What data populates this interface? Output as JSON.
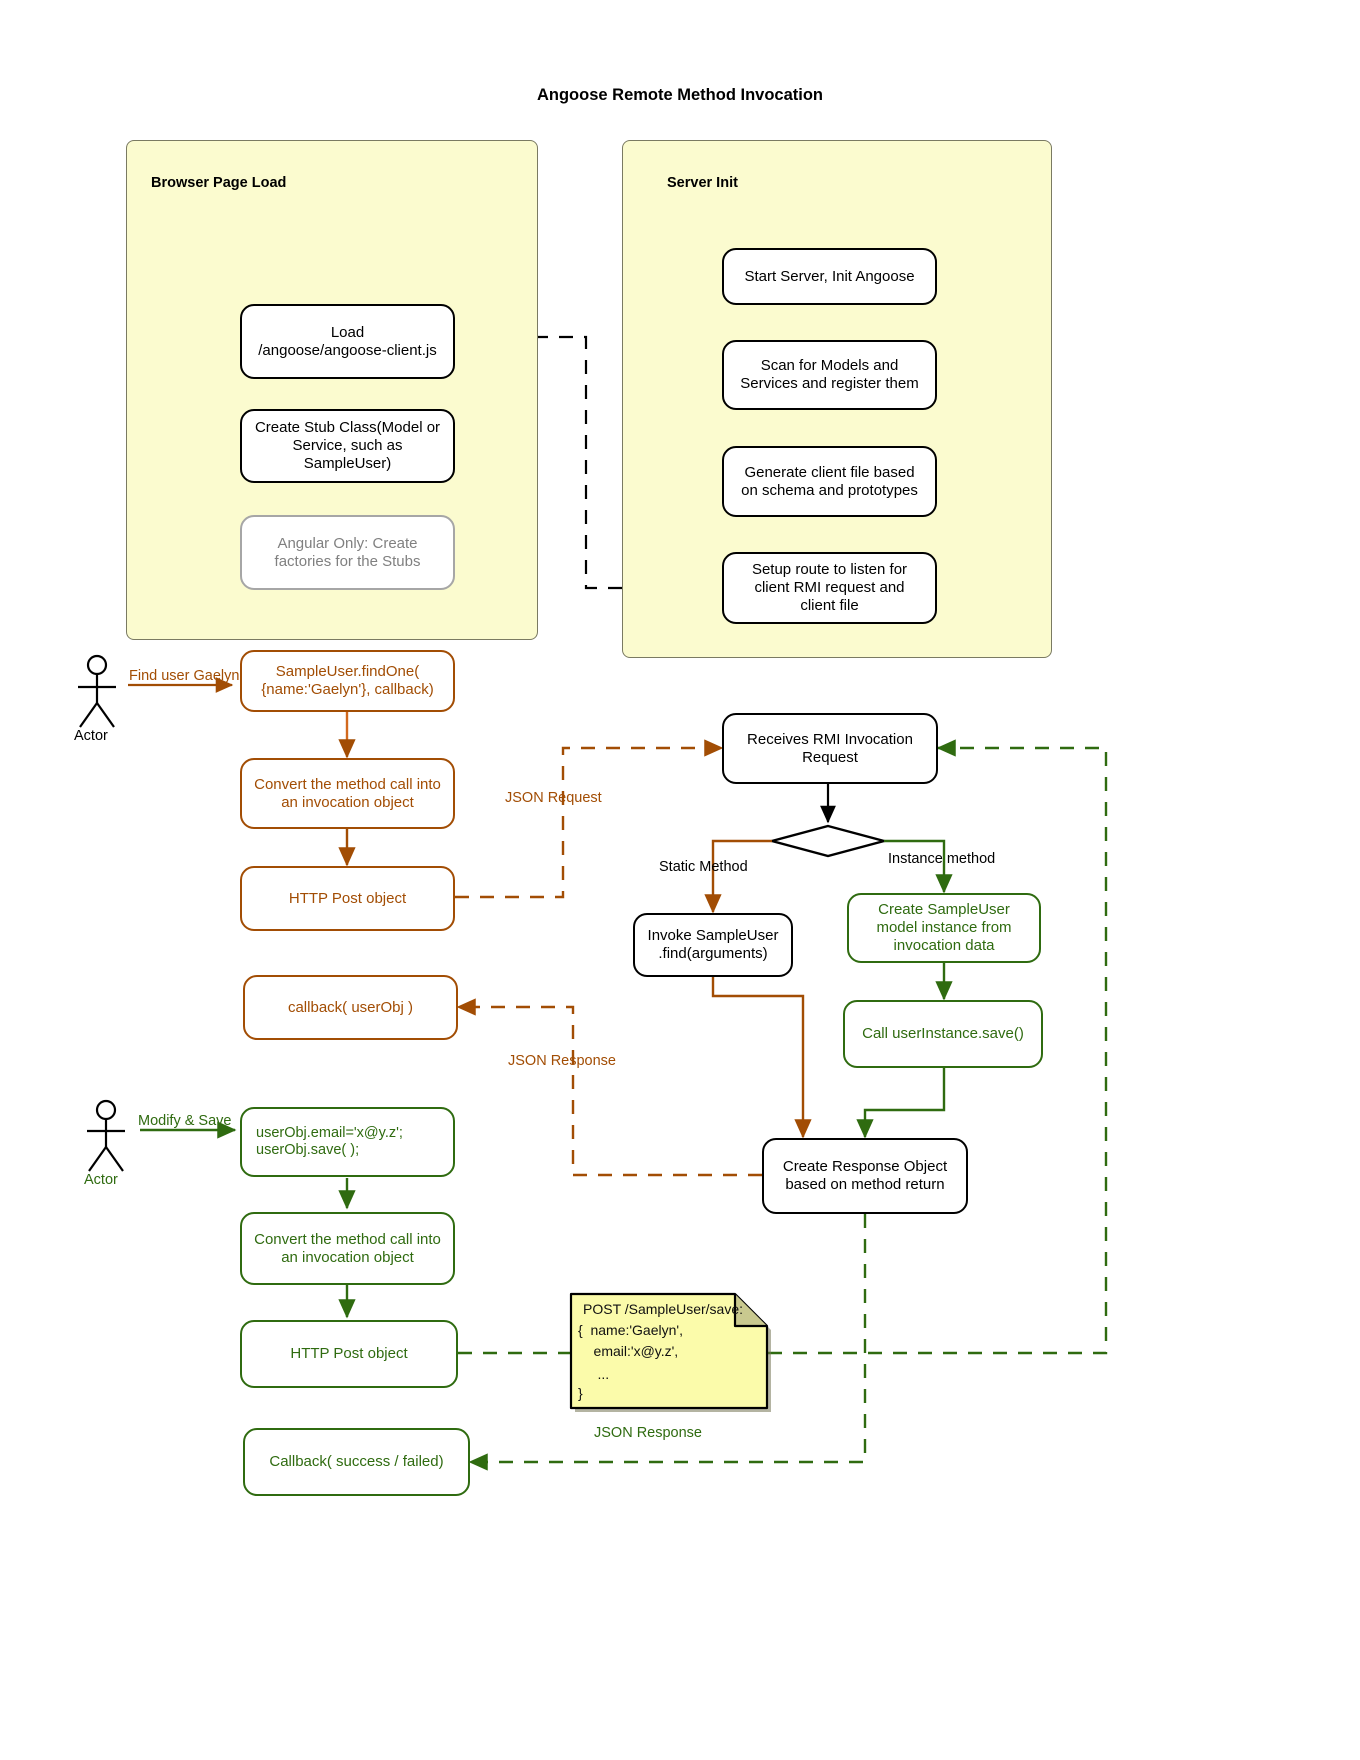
{
  "page": {
    "title": "Angoose Remote Method Invocation",
    "background": "#ffffff"
  },
  "colors": {
    "frame_fill": "#fbfbcf",
    "frame_stroke": "#7a7a62",
    "black": "#000000",
    "grey": "#808080",
    "orange": "#a24d04",
    "green": "#2f6b10",
    "note_fill": "#fbfbaa"
  },
  "frames": [
    {
      "id": "browser",
      "label": "Browser Page Load"
    },
    {
      "id": "server",
      "label": "Server Init"
    }
  ],
  "browser_flow": {
    "start_node": "filled-circle-start",
    "nodes": [
      {
        "id": "load-client",
        "label": "Load\n/angoose/angoose-client.js",
        "style": "black"
      },
      {
        "id": "create-stub",
        "label": "Create Stub Class(Model or\nService, such as\nSampleUser)",
        "style": "black"
      },
      {
        "id": "angular-factories",
        "label": "Angular Only: Create\nfactories for the Stubs",
        "style": "grey"
      }
    ]
  },
  "server_flow": {
    "start_node": "filled-circle-start",
    "nodes": [
      {
        "id": "start-server",
        "label": "Start Server, Init Angoose",
        "style": "black"
      },
      {
        "id": "scan-models",
        "label": "Scan for Models and\nServices and register them",
        "style": "black"
      },
      {
        "id": "generate-client",
        "label": "Generate client file based\non schema and prototypes",
        "style": "black"
      },
      {
        "id": "setup-route",
        "label": "Setup route to listen for\nclient RMI request and\nclient file",
        "style": "black"
      }
    ]
  },
  "actors": [
    {
      "id": "actor-find",
      "caption": "Actor",
      "action_label": "Find user Gaelyn",
      "color": "orange"
    },
    {
      "id": "actor-save",
      "caption": "Actor",
      "action_label": "Modify & Save",
      "color": "green"
    }
  ],
  "client_find_flow": {
    "nodes": [
      {
        "id": "find-one",
        "label": "SampleUser.findOne(\n{name:'Gaelyn'}, callback)",
        "style": "orange"
      },
      {
        "id": "convert-invocation-1",
        "label": "Convert the method call into\nan invocation object",
        "style": "orange"
      },
      {
        "id": "http-post-1",
        "label": "HTTP Post object",
        "style": "orange"
      },
      {
        "id": "callback-userobj",
        "label": "callback( userObj )",
        "style": "orange"
      }
    ]
  },
  "client_save_flow": {
    "nodes": [
      {
        "id": "modify-save",
        "label": "userObj.email='x@y.z';\nuserObj.save(   );",
        "style": "green"
      },
      {
        "id": "convert-invocation-2",
        "label": "Convert the method call into\nan invocation object",
        "style": "green"
      },
      {
        "id": "http-post-2",
        "label": "HTTP Post object",
        "style": "green"
      },
      {
        "id": "callback-result",
        "label": "Callback( success / failed)",
        "style": "green"
      }
    ]
  },
  "server_rmi_flow": {
    "nodes": [
      {
        "id": "receives-rmi",
        "label": "Receives RMI Invocation\nRequest",
        "style": "black"
      },
      {
        "id": "decision",
        "label": "",
        "style": "diamond"
      },
      {
        "id": "invoke-find",
        "label": "Invoke SampleUser\n.find(arguments)",
        "style": "black"
      },
      {
        "id": "create-model-instance",
        "label": "Create SampleUser\nmodel instance from\ninvocation data",
        "style": "green"
      },
      {
        "id": "call-save",
        "label": "Call userInstance.save()",
        "style": "green"
      },
      {
        "id": "create-response",
        "label": "Create Response Object\nbased on method return",
        "style": "black"
      }
    ],
    "branch_labels": [
      {
        "id": "static-method-label",
        "text": "Static Method"
      },
      {
        "id": "instance-method-label",
        "text": "Instance method"
      }
    ]
  },
  "connection_labels": [
    {
      "id": "json-request-label",
      "text": "JSON Request",
      "color": "orange"
    },
    {
      "id": "json-response-label-1",
      "text": "JSON Response",
      "color": "orange"
    },
    {
      "id": "json-response-label-2",
      "text": "JSON Response",
      "color": "green"
    }
  ],
  "note": {
    "id": "post-payload-note",
    "lines": [
      "POST /SampleUser/save:",
      "{  name:'Gaelyn',",
      "    email:'x@y.z',",
      "     ...",
      "}"
    ]
  }
}
